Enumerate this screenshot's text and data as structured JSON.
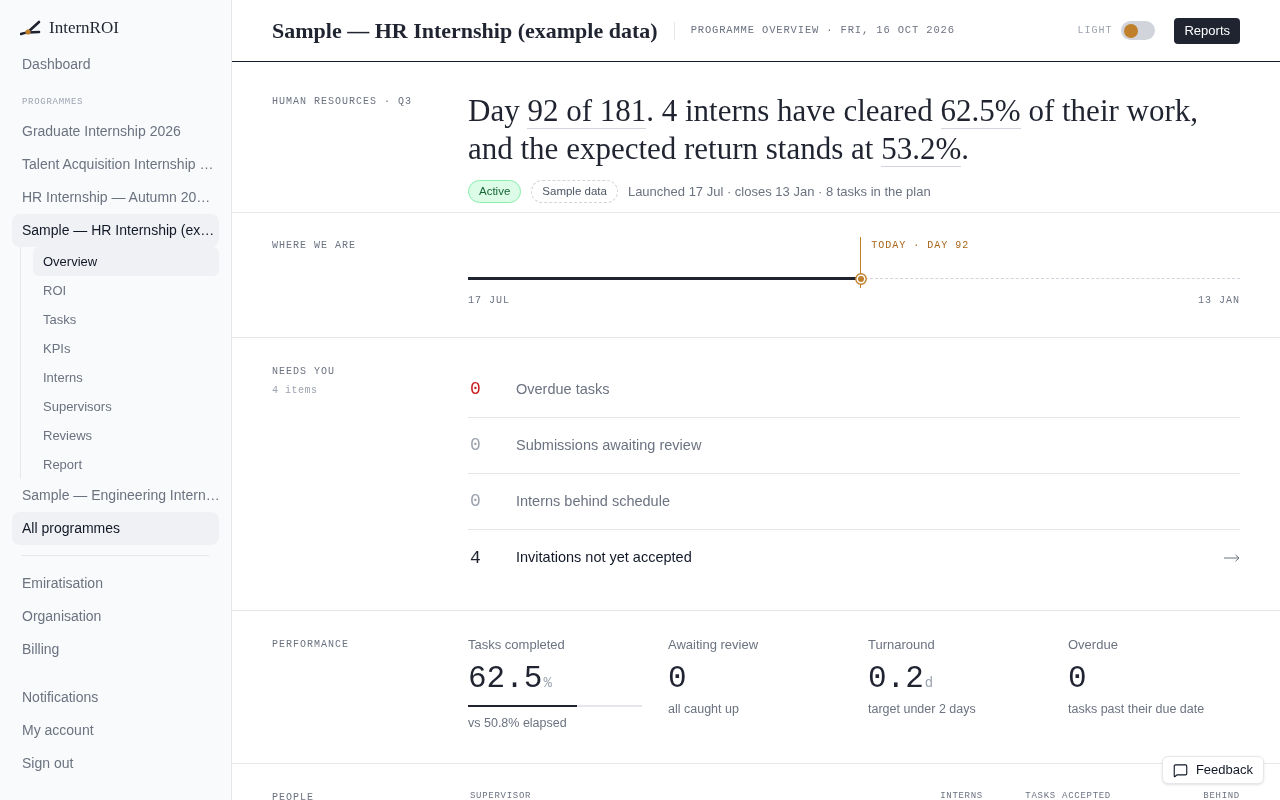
{
  "sidebar": {
    "brand": "InternROI",
    "top_items": [
      {
        "label": "Dashboard",
        "selected": false
      }
    ],
    "section_label": "PROGRAMMES",
    "programmes": [
      {
        "label": "Graduate Internship 2026",
        "selected": false
      },
      {
        "label": "Talent Acquisition Internship …",
        "selected": false
      },
      {
        "label": "HR Internship — Autumn 20…",
        "selected": false
      },
      {
        "label": "Sample — HR Internship (ex…",
        "selected": true,
        "children": [
          {
            "label": "Overview",
            "selected": true
          },
          {
            "label": "ROI",
            "selected": false
          },
          {
            "label": "Tasks",
            "selected": false
          },
          {
            "label": "KPIs",
            "selected": false
          },
          {
            "label": "Interns",
            "selected": false
          },
          {
            "label": "Supervisors",
            "selected": false
          },
          {
            "label": "Reviews",
            "selected": false
          },
          {
            "label": "Report",
            "selected": false
          }
        ]
      },
      {
        "label": "Sample — Engineering Intern…",
        "selected": false
      },
      {
        "label": "All programmes",
        "selected": true
      }
    ],
    "admin_items": [
      {
        "label": "Emiratisation",
        "selected": false
      },
      {
        "label": "Organisation",
        "selected": false
      },
      {
        "label": "Billing",
        "selected": false
      }
    ],
    "account_items": [
      {
        "label": "Notifications",
        "selected": false
      },
      {
        "label": "My account",
        "selected": false
      },
      {
        "label": "Sign out",
        "selected": false
      }
    ]
  },
  "header": {
    "title": "Sample — HR Internship (example data)",
    "subtitle": "PROGRAMME OVERVIEW · FRI, 16 OCT 2026",
    "theme_toggle": {
      "label": "LIGHT",
      "on": false
    },
    "reports_button": "Reports"
  },
  "hero": {
    "label": "HUMAN RESOURCES · Q3",
    "headline": [
      {
        "text": "Day ",
        "underlined": false
      },
      {
        "text": "92 of 181",
        "underlined": true
      },
      {
        "text": ". 4 interns have cleared ",
        "underlined": false
      },
      {
        "text": "62.5%",
        "underlined": true
      },
      {
        "text": " of their work, and the expected return stands at ",
        "underlined": false
      },
      {
        "text": "53.2%",
        "underlined": true
      },
      {
        "text": ".",
        "underlined": false
      }
    ],
    "badges": [
      {
        "text": "Active",
        "kind": "status"
      },
      {
        "text": "Sample data",
        "kind": "tag"
      }
    ],
    "meta": "Launched 17 Jul · closes 13 Jan · 8 tasks in the plan"
  },
  "timeline": {
    "label": "WHERE WE ARE",
    "marker_label": "TODAY · DAY 92",
    "level": 0.508,
    "start": "17 JUL",
    "end": "13 JAN"
  },
  "needs": {
    "label": "NEEDS YOU",
    "count": "4 items",
    "rows": [
      {
        "count": "0",
        "text": "Overdue tasks",
        "kind": "alert"
      },
      {
        "count": "0",
        "text": "Submissions awaiting review",
        "kind": "muted"
      },
      {
        "count": "0",
        "text": "Interns behind schedule",
        "kind": "muted"
      },
      {
        "count": "4",
        "text": "Invitations not yet accepted",
        "kind": "action"
      }
    ]
  },
  "performance": {
    "label": "PERFORMANCE",
    "metrics": [
      {
        "label": "Tasks completed",
        "value": "62.5",
        "unit": "%",
        "level": 0.625,
        "note": "vs 50.8% elapsed"
      },
      {
        "label": "Awaiting review",
        "value": "0",
        "note": "all caught up"
      },
      {
        "label": "Turnaround",
        "value": "0.2",
        "unit": "d",
        "note": "target under 2 days"
      },
      {
        "label": "Overdue",
        "value": "0",
        "note": "tasks past their due date"
      }
    ]
  },
  "people": {
    "label": "PEOPLE",
    "columns": [
      "SUPERVISOR",
      "INTERNS",
      "TASKS ACCEPTED",
      "BEHIND"
    ]
  },
  "feedback_button": "Feedback"
}
